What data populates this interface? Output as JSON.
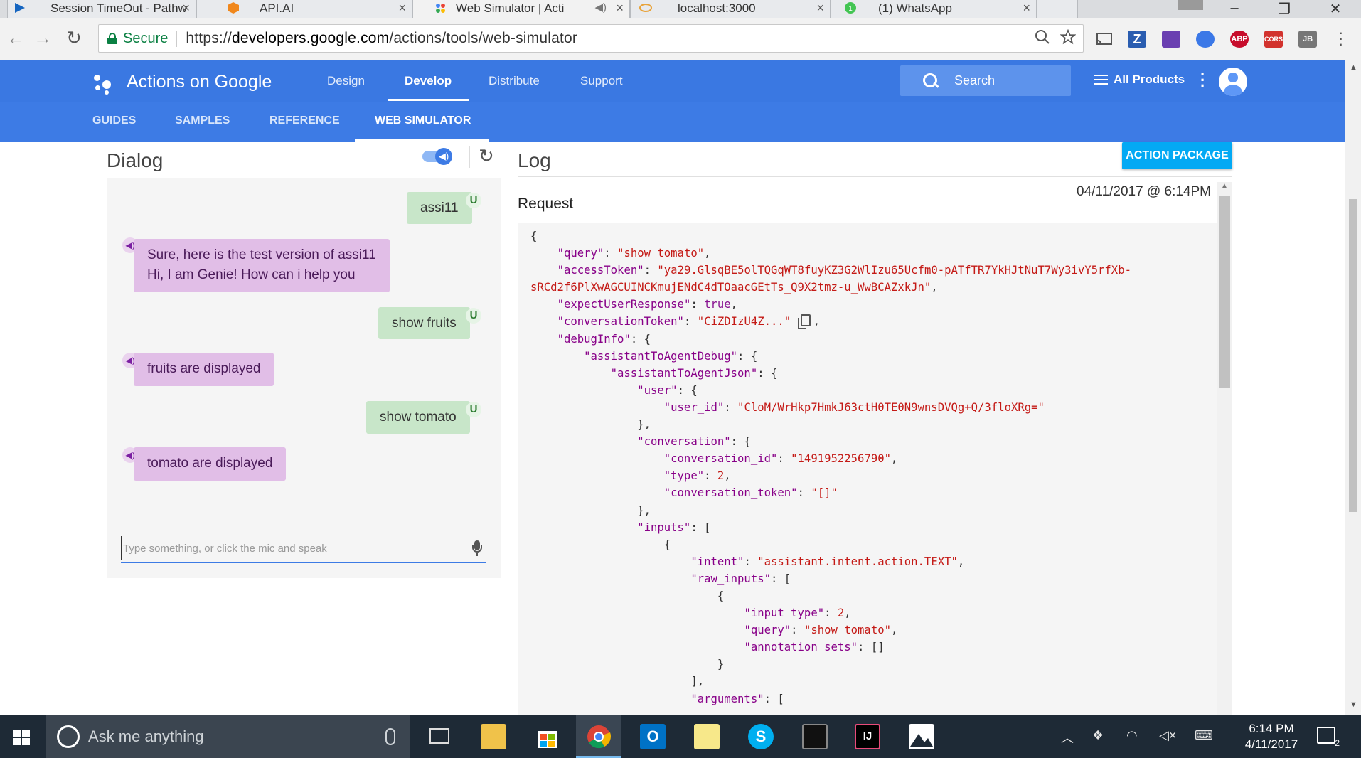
{
  "browser": {
    "tabs": [
      {
        "title": "Session TimeOut - Pathw",
        "active": false
      },
      {
        "title": "API.AI",
        "active": false
      },
      {
        "title": "Web Simulator  |  Acti",
        "active": true
      },
      {
        "title": "localhost:3000",
        "active": false
      },
      {
        "title": "(1) WhatsApp",
        "active": false
      }
    ],
    "secure_label": "Secure",
    "url_scheme": "https://",
    "url_host": "developers.google.com",
    "url_path": "/actions/tools/web-simulator",
    "extensions": [
      {
        "icon": "cast-icon",
        "label": ""
      },
      {
        "icon": "zotero-icon",
        "label": "Z",
        "color": "#2a5db0"
      },
      {
        "icon": "extension-icon",
        "label": "",
        "color": "#6a3fb1"
      },
      {
        "icon": "extension-icon",
        "label": "",
        "color": "#3b78e7"
      },
      {
        "icon": "adblock-icon",
        "label": "ABP",
        "color": "#c70d2c"
      },
      {
        "icon": "cors-icon",
        "label": "CORS",
        "color": "#d2322d"
      },
      {
        "icon": "jb-icon",
        "label": "JB",
        "color": "#777777"
      }
    ]
  },
  "site": {
    "brand": "Actions on Google",
    "nav": [
      "Design",
      "Develop",
      "Distribute",
      "Support"
    ],
    "nav_active": "Develop",
    "search_label": "Search",
    "all_products": "All Products",
    "subnav": [
      "GUIDES",
      "SAMPLES",
      "REFERENCE",
      "WEB SIMULATOR"
    ],
    "subnav_active": "WEB SIMULATOR",
    "accent": "#3d7be5"
  },
  "dialog": {
    "title": "Dialog",
    "user_badge": "U",
    "messages": [
      {
        "from": "user",
        "text": "assi11"
      },
      {
        "from": "agent",
        "lines": [
          "Sure, here is the test version of assi11",
          "Hi, I am Genie! How can i help you"
        ]
      },
      {
        "from": "user",
        "text": "show fruits"
      },
      {
        "from": "agent",
        "lines": [
          "fruits are displayed"
        ]
      },
      {
        "from": "user",
        "text": "show tomato"
      },
      {
        "from": "agent",
        "lines": [
          "tomato are displayed"
        ]
      }
    ],
    "input_placeholder": "Type something, or click the mic and speak",
    "input_value": ""
  },
  "log": {
    "title": "Log",
    "action_package": "ACTION PACKAGE",
    "timestamp": "04/11/2017 @ 6:14PM",
    "request_title": "Request",
    "request": {
      "query": "show tomato",
      "accessToken_line1": "ya29.GlsqBE5olTQGqWT8fuyKZ3G2WlIzu65Ucfm0-pATfTR7YkHJtNuT7Wy3ivY5rfXb-",
      "accessToken_line2": "sRCd2f6PlXwAGCUINCKmujENdC4dTOaacGEtTs_Q9X2tmz-u_WwBCAZxkJn",
      "expectUserResponse": "true",
      "conversationToken": "CiZDIzU4Z...",
      "user_id": "CloM/WrHkp7HmkJ63ctH0TE0N9wnsDVQg+Q/3floXRg=",
      "conversation_id": "1491952256790",
      "type": "2",
      "conversation_token": "[]",
      "intent": "assistant.intent.action.TEXT",
      "input_type": "2",
      "raw_query": "show tomato",
      "annotation_sets": "[]"
    }
  },
  "taskbar": {
    "cortana_placeholder": "Ask me anything",
    "time": "6:14 PM",
    "date": "4/11/2017",
    "notification_count": "2",
    "apps": [
      "task-view-icon",
      "file-explorer-icon",
      "store-icon",
      "chrome-icon",
      "outlook-icon",
      "sticky-notes-icon",
      "skype-icon",
      "terminal-icon",
      "intellij-icon",
      "photos-icon"
    ]
  }
}
